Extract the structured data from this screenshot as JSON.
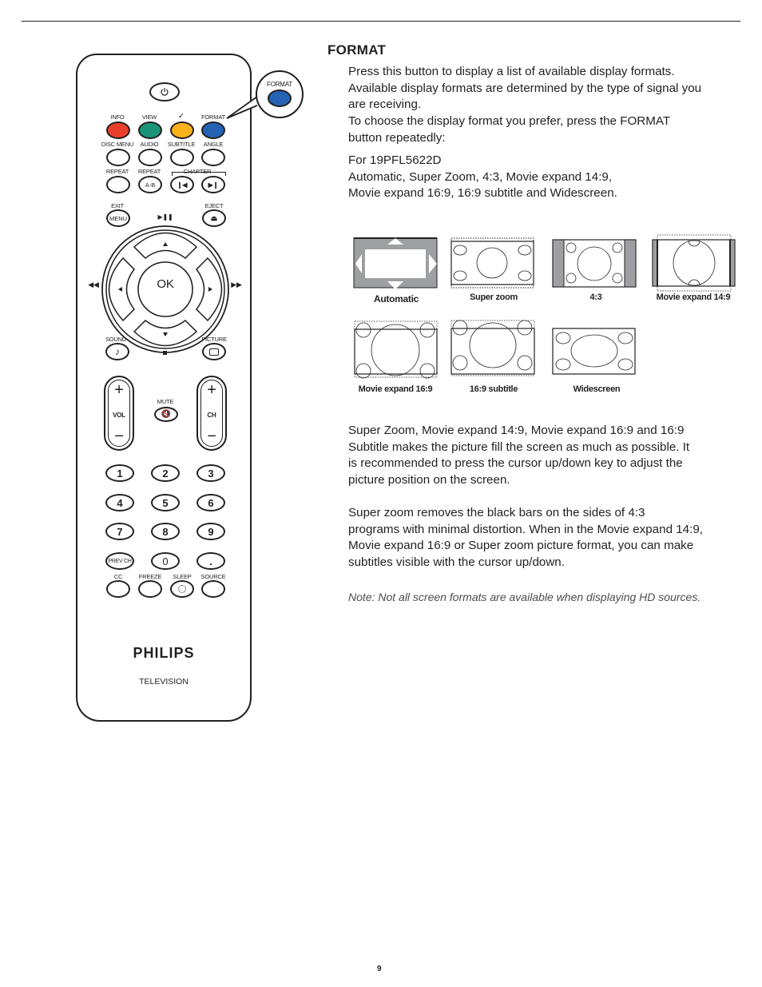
{
  "document": {
    "page_number": "9",
    "section_title": "FORMAT",
    "intro_lines": [
      "Press this button to display a list of available display formats.",
      "Available display formats are determined by the type of signal you",
      "are receiving.",
      "To choose the display format you prefer, press the FORMAT",
      "button repeatedly:"
    ],
    "model_lines": [
      "For 19PFL5622D",
      "Automatic, Super Zoom, 4:3, Movie expand 14:9,",
      "Movie expand 16:9, 16:9 subtitle and Widescreen."
    ],
    "para2_lines": [
      "Super Zoom, Movie expand 14:9, Movie expand 16:9 and 16:9",
      "Subtitle makes the picture fill the screen as much as possible. It",
      "is recommended to press the cursor up/down key to adjust the",
      "picture position on the screen."
    ],
    "para3_lines": [
      "Super zoom removes the black bars on the sides of 4:3",
      "programs with minimal distortion. When in the Movie expand 14:9,",
      "Movie expand 16:9 or Super zoom picture format, you can make",
      "subtitles visible with the cursor up/down."
    ],
    "note": "Note: Not all screen formats are available when displaying HD sources."
  },
  "formats": [
    {
      "label": "Automatic"
    },
    {
      "label": "Super zoom"
    },
    {
      "label": "4:3"
    },
    {
      "label": "Movie expand 14:9"
    },
    {
      "label": "Movie expand 16:9"
    },
    {
      "label": "16:9 subtitle"
    },
    {
      "label": "Widescreen"
    }
  ],
  "remote": {
    "brand": "PHILIPS",
    "subtitle": "TELEVISION",
    "callout_label": "FORMAT",
    "colors": {
      "red": "#e8402a",
      "green": "#1a9479",
      "yellow": "#f9b21b",
      "blue": "#2463b4",
      "gray": "#9d9fa2"
    },
    "labels": {
      "info": "INFO",
      "view": "VIEW",
      "check": "✓",
      "format": "FORMAT",
      "disc_menu": "DISC MENU",
      "audio": "AUDIO",
      "subtitle": "SUBTITLE",
      "angle": "ANGLE",
      "repeat": "REPEAT",
      "repeat_ab": "REPEAT",
      "chapter": "CHAPTER",
      "ab": "A-B",
      "exit": "EXIT",
      "menu": "MENU",
      "eject": "EJECT",
      "play_pause": "▶❚❚",
      "ok": "OK",
      "sound": "SOUND",
      "picture": "PICTURE",
      "vol": "VOL",
      "ch": "CH",
      "mute": "MUTE",
      "plus": "+",
      "minus": "−",
      "cc": "CC",
      "freeze": "FREEZE",
      "sleep": "SLEEP",
      "source": "SOURCE",
      "prev_ch": "PREV CH",
      "dot": "."
    },
    "digits": [
      "1",
      "2",
      "3",
      "4",
      "5",
      "6",
      "7",
      "8",
      "9"
    ],
    "zero": "0"
  }
}
